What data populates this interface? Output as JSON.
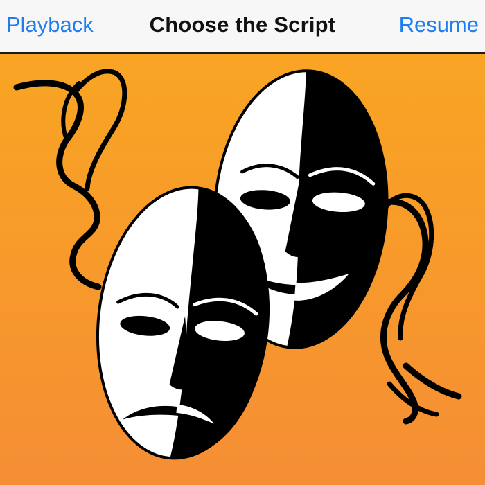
{
  "navbar": {
    "left_button": "Playback",
    "title": "Choose the Script",
    "right_button": "Resume"
  },
  "colors": {
    "accent": "#1e7ef0",
    "navbar_bg": "#f7f7f7",
    "background_top": "#f9a523",
    "background_bottom": "#f58e35"
  },
  "artwork": {
    "icon": "theater-masks-icon"
  }
}
